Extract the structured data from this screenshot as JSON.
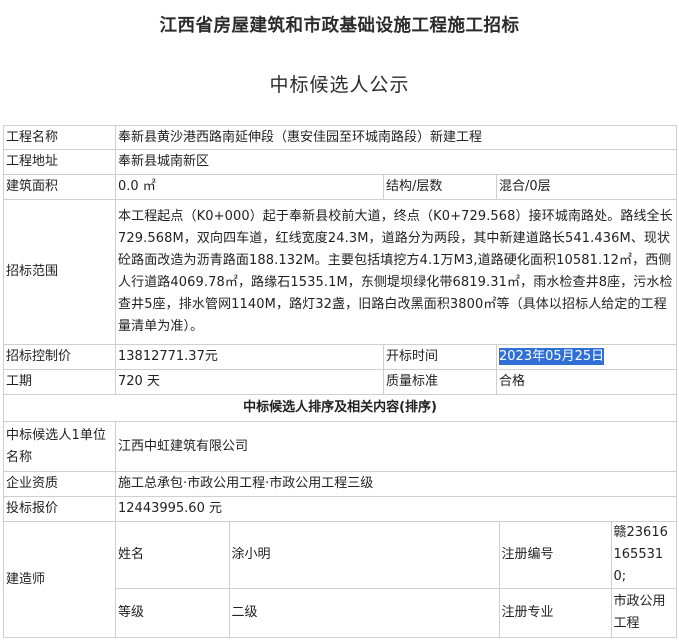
{
  "header": {
    "org_title": "江西省房屋建筑和市政基础设施工程施工招标",
    "doc_title": "中标候选人公示"
  },
  "project": {
    "name_label": "工程名称",
    "name_value": "奉新县黄沙港西路南延伸段（惠安佳园至环城南路段）新建工程",
    "address_label": "工程地址",
    "address_value": "奉新县城南新区",
    "area_label": "建筑面积",
    "area_value": "0.0 ㎡",
    "structure_label": "结构/层数",
    "structure_value": "混合/0层",
    "scope_label": "招标范围",
    "scope_value": "本工程起点（K0+000）起于奉新县校前大道，终点（K0+729.568）接环城南路处。路线全长729.568M，双向四车道，红线宽度24.3M，道路分为两段，其中新建道路长541.436M、现状砼路面改造为沥青路面188.132M。主要包括填挖方4.1万M3,道路硬化面积10581.12㎡，西侧人行道路4069.78㎡，路缘石1535.1M，东侧堤坝绿化带6819.31㎡，雨水检查井8座，污水检查井5座，排水管网1140M，路灯32盏，旧路白改黑面积3800㎡等（具体以招标人给定的工程量清单为准）。",
    "control_price_label": "招标控制价",
    "control_price_value": "13812771.37元",
    "open_time_label": "开标时间",
    "open_time_value": "2023年05月25日",
    "duration_label": "工期",
    "duration_value": "720 天",
    "quality_label": "质量标准",
    "quality_value": "合格"
  },
  "candidate": {
    "section_title": "中标候选人排序及相关内容(排序)",
    "unit_label": "中标候选人1单位名称",
    "unit_value": "江西中虹建筑有限公司",
    "qualification_label": "企业资质",
    "qualification_value": "施工总承包·市政公用工程·市政公用工程三级",
    "bid_label": "投标报价",
    "bid_value": "12443995.60 元",
    "builder_label": "建造师",
    "builder": {
      "name_label": "姓名",
      "name_value": "涂小明",
      "reg_no_label": "注册编号",
      "reg_no_value": "赣236161655310;",
      "grade_label": "等级",
      "grade_value": "二级",
      "specialty_label": "注册专业",
      "specialty_value": "市政公用工程"
    }
  },
  "colors": {
    "highlight": "#2f6fd6",
    "border": "#cfcfcf"
  }
}
